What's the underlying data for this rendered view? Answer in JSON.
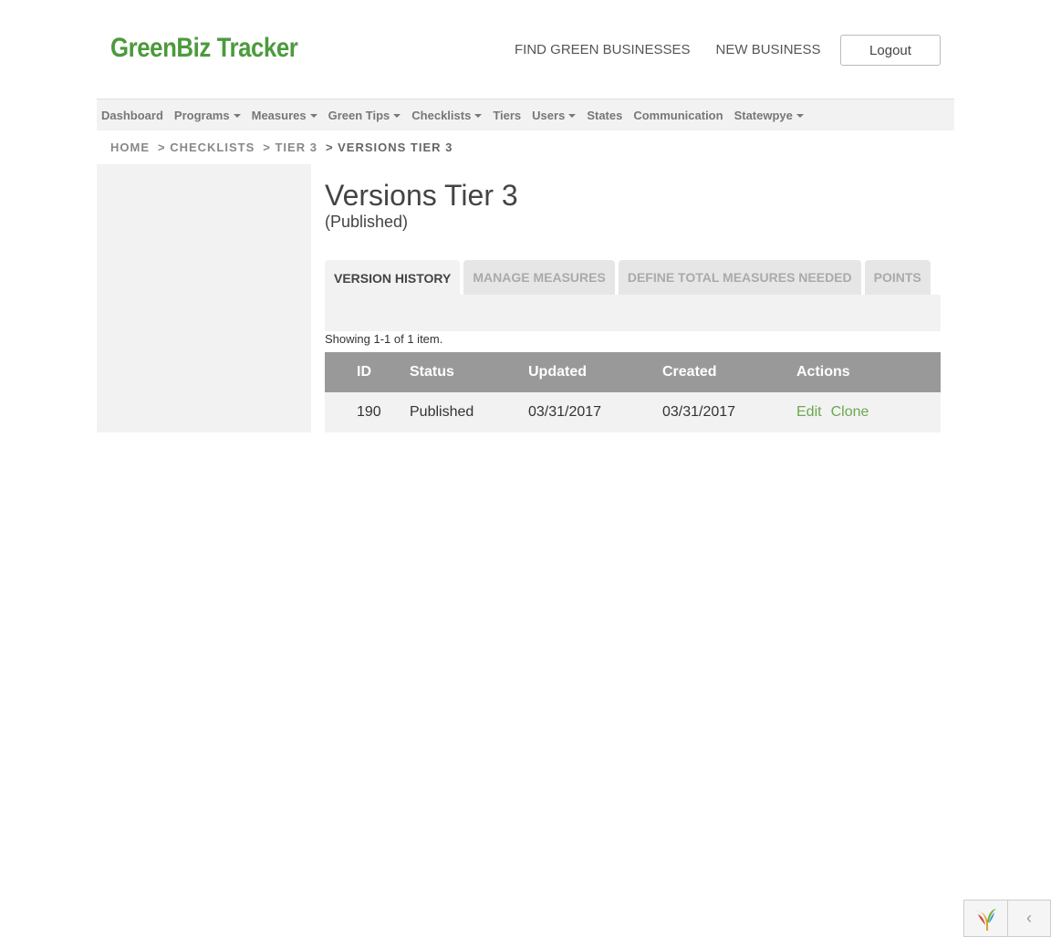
{
  "header": {
    "logo_text": "GreenBiz Tracker",
    "nav": [
      "FIND GREEN BUSINESSES",
      "NEW BUSINESS"
    ],
    "logout_label": "Logout"
  },
  "menu": {
    "items": [
      {
        "label": "Dashboard",
        "dropdown": false
      },
      {
        "label": "Programs",
        "dropdown": true
      },
      {
        "label": "Measures",
        "dropdown": true
      },
      {
        "label": "Green Tips",
        "dropdown": true
      },
      {
        "label": "Checklists",
        "dropdown": true
      },
      {
        "label": "Tiers",
        "dropdown": false
      },
      {
        "label": "Users",
        "dropdown": true
      },
      {
        "label": "States",
        "dropdown": false
      },
      {
        "label": "Communication",
        "dropdown": false
      },
      {
        "label": "Statewpye",
        "dropdown": true
      }
    ]
  },
  "breadcrumb": {
    "items": [
      "HOME",
      "> CHECKLISTS",
      "> TIER 3"
    ],
    "current": "> VERSIONS TIER 3"
  },
  "page": {
    "title": "Versions Tier 3",
    "subtitle": "(Published)"
  },
  "tabs": [
    {
      "label": "VERSION HISTORY",
      "active": true
    },
    {
      "label": "MANAGE MEASURES",
      "active": false
    },
    {
      "label": "DEFINE TOTAL MEASURES NEEDED",
      "active": false
    },
    {
      "label": "POINTS",
      "active": false
    }
  ],
  "grid": {
    "summary": "Showing 1-1 of 1 item.",
    "columns": [
      "ID",
      "Status",
      "Updated",
      "Created",
      "Actions"
    ],
    "rows": [
      {
        "id": "190",
        "status": "Published",
        "updated": "03/31/2017",
        "created": "03/31/2017",
        "actions": [
          "Edit",
          "Clone"
        ]
      }
    ]
  },
  "colors": {
    "brand_green": "#4c9a3c",
    "link_green": "#6aa84f",
    "table_header": "#999999",
    "panel_bg": "#f2f2f2"
  },
  "debug_toolbar": {
    "logo_icon": "yii-logo-icon",
    "toggle_glyph": "‹"
  }
}
